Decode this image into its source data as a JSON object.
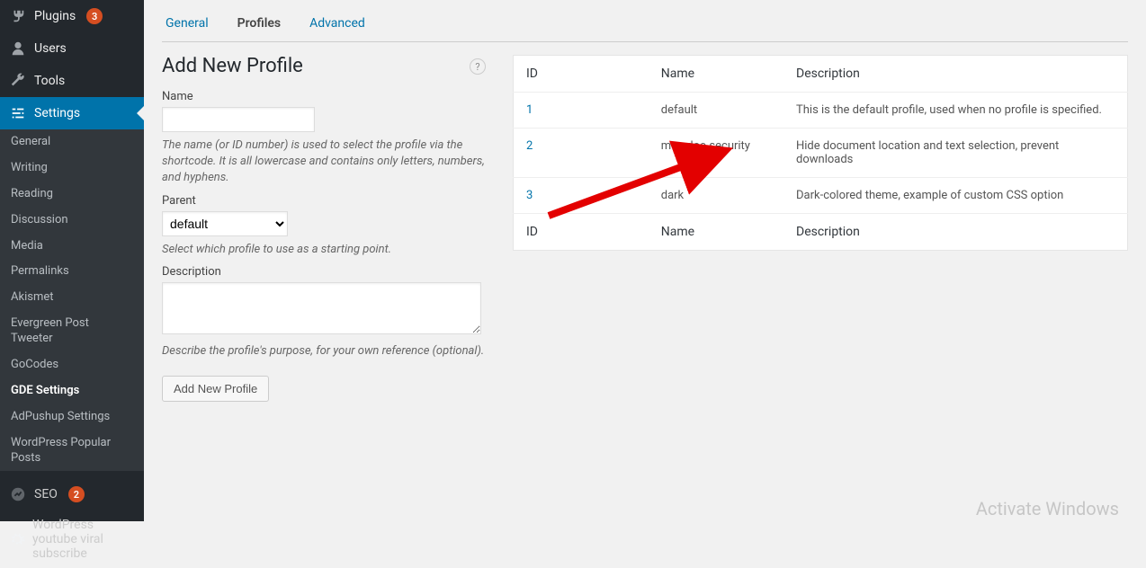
{
  "sidebar": {
    "top": [
      {
        "label": "Plugins",
        "icon": "plug",
        "badge": "3"
      },
      {
        "label": "Users",
        "icon": "user"
      },
      {
        "label": "Tools",
        "icon": "wrench"
      },
      {
        "label": "Settings",
        "icon": "sliders",
        "active": true
      }
    ],
    "submenu": [
      {
        "label": "General"
      },
      {
        "label": "Writing"
      },
      {
        "label": "Reading"
      },
      {
        "label": "Discussion"
      },
      {
        "label": "Media"
      },
      {
        "label": "Permalinks"
      },
      {
        "label": "Akismet"
      },
      {
        "label": "Evergreen Post Tweeter"
      },
      {
        "label": "GoCodes"
      },
      {
        "label": "GDE Settings",
        "current": true
      },
      {
        "label": "AdPushup Settings"
      },
      {
        "label": "WordPress Popular Posts"
      }
    ],
    "bottom": [
      {
        "label": "SEO",
        "icon": "seo",
        "badge": "2"
      },
      {
        "label": "WordPress youtube viral subscribe",
        "icon": "gear"
      }
    ]
  },
  "tabs": [
    {
      "label": "General"
    },
    {
      "label": "Profiles",
      "active": true
    },
    {
      "label": "Advanced"
    }
  ],
  "form": {
    "title": "Add New Profile",
    "name_label": "Name",
    "name_value": "",
    "name_hint": "The name (or ID number) is used to select the profile via the shortcode. It is all lowercase and contains only letters, numbers, and hyphens.",
    "parent_label": "Parent",
    "parent_value": "default",
    "parent_hint": "Select which profile to use as a starting point.",
    "desc_label": "Description",
    "desc_value": "",
    "desc_hint": "Describe the profile's purpose, for your own reference (optional).",
    "submit_label": "Add New Profile"
  },
  "table": {
    "headers": {
      "id": "ID",
      "name": "Name",
      "desc": "Description"
    },
    "rows": [
      {
        "id": "1",
        "name": "default",
        "desc": "This is the default profile, used when no profile is specified."
      },
      {
        "id": "2",
        "name": "max-doc-security",
        "desc": "Hide document location and text selection, prevent downloads"
      },
      {
        "id": "3",
        "name": "dark",
        "desc": "Dark-colored theme, example of custom CSS option"
      }
    ]
  },
  "watermark": "Activate Windows"
}
